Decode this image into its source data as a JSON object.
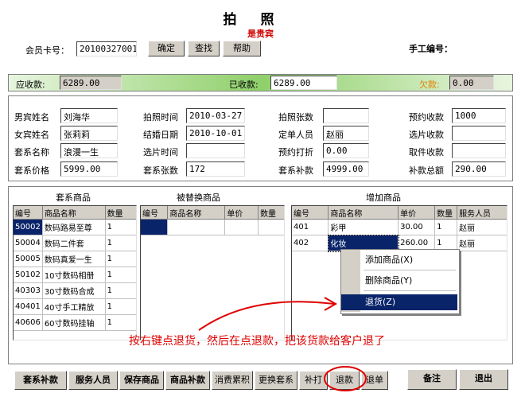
{
  "header": {
    "title": "拍照",
    "subtitle": "是贵宾"
  },
  "top": {
    "member_label": "会员卡号：",
    "member_value": "20100327001",
    "buttons": [
      "确定",
      "查找",
      "帮助"
    ],
    "manual_label": "手工编号："
  },
  "band": {
    "receivable_label": "应收款:",
    "receivable_value": "6289.00",
    "received_label": "已收款:",
    "received_value": "6289.00",
    "owed_label": "欠款:",
    "owed_value": "0.00"
  },
  "info": {
    "c1": [
      {
        "label": "男宾姓名",
        "value": "刘海华"
      },
      {
        "label": "女宾姓名",
        "value": "张莉莉"
      },
      {
        "label": "套系名称",
        "value": "浪漫一生"
      },
      {
        "label": "套系价格",
        "value": "5999.00"
      }
    ],
    "c2": [
      {
        "label": "拍照时间",
        "value": "2010-03-27"
      },
      {
        "label": "结婚日期",
        "value": "2010-10-01"
      },
      {
        "label": "选片时间",
        "value": ""
      },
      {
        "label": "套系张数",
        "value": "172"
      }
    ],
    "c3": [
      {
        "label": "拍照张数",
        "value": ""
      },
      {
        "label": "定单人员",
        "value": "赵丽"
      },
      {
        "label": "预约打折",
        "value": "0.00"
      },
      {
        "label": "套系补款",
        "value": "4999.00"
      }
    ],
    "c4": [
      {
        "label": "预约收款",
        "value": "1000"
      },
      {
        "label": "选片收款",
        "value": ""
      },
      {
        "label": "取件收款",
        "value": ""
      },
      {
        "label": "补款总额",
        "value": "290.00"
      }
    ]
  },
  "grids": {
    "package": {
      "title": "套系商品",
      "headers": [
        "编号",
        "商品名称",
        "数量"
      ],
      "rows": [
        [
          "50002",
          "数码路易至尊",
          "1"
        ],
        [
          "50004",
          "数码二件套",
          "1"
        ],
        [
          "50005",
          "数码真爱一生",
          "1"
        ],
        [
          "50102",
          "10寸数码相册",
          "1"
        ],
        [
          "40303",
          "30寸数码合成",
          "1"
        ],
        [
          "40401",
          "40寸手工精放",
          "1"
        ],
        [
          "40606",
          "60寸数码挂轴",
          "1"
        ]
      ]
    },
    "replaced": {
      "title": "被替换商品",
      "headers": [
        "编号",
        "商品名称",
        "单价",
        "数量"
      ]
    },
    "added": {
      "title": "增加商品",
      "headers": [
        "编号",
        "商品名称",
        "单价",
        "数量",
        "服务人员"
      ],
      "rows": [
        [
          "401",
          "彩甲",
          "30.00",
          "1",
          "赵丽"
        ],
        [
          "402",
          "化妆",
          "260.00",
          "1",
          "赵丽"
        ]
      ]
    }
  },
  "context_menu": {
    "items": [
      "添加商品(X)",
      "删除商品(Y)",
      "退货(Z)"
    ]
  },
  "annotation": "按右键点退货，然后在点退款，把该货款给客户退了",
  "bottom_buttons": [
    "套系补款",
    "服务人员",
    "保存商品",
    "商品补款",
    "消费累积",
    "更换套系",
    "补打",
    "退款",
    "退单",
    "备注",
    "退出"
  ],
  "colors": {
    "accent_red": "#e00000",
    "selection": "#0a246a"
  }
}
